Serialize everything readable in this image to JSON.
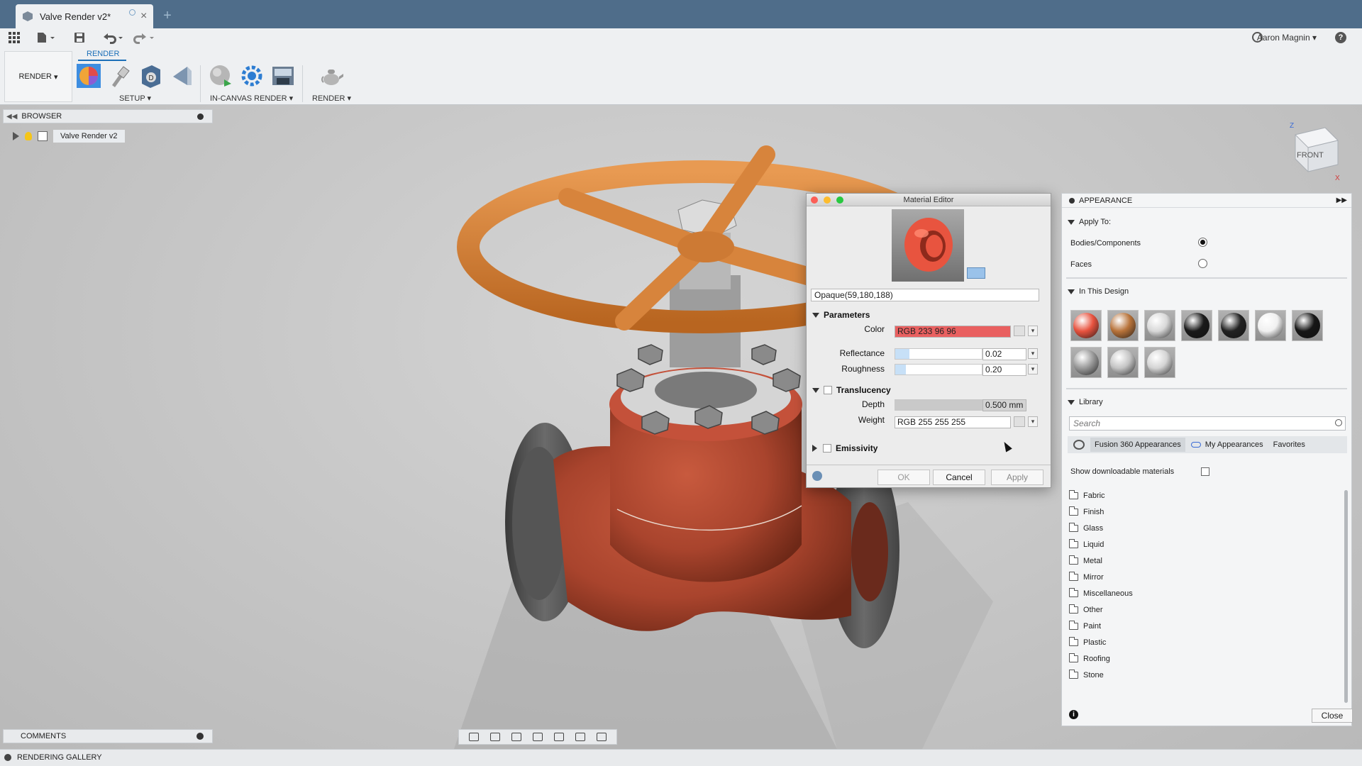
{
  "tab": {
    "title": "Valve Render v2*"
  },
  "user": {
    "name": "Aaron Magnin"
  },
  "ribbon": {
    "workspace": "RENDER",
    "active_tab": "RENDER",
    "groups": [
      "SETUP",
      "IN-CANVAS RENDER",
      "RENDER"
    ]
  },
  "browser": {
    "title": "BROWSER",
    "root": "Valve Render v2"
  },
  "comments": {
    "title": "COMMENTS"
  },
  "gallery": {
    "title": "RENDERING GALLERY"
  },
  "viewcube": {
    "face": "FRONT",
    "axis_z": "Z",
    "axis_x": "X"
  },
  "material_editor": {
    "title": "Material Editor",
    "name": "Opaque(59,180,188)",
    "parameters_label": "Parameters",
    "color_label": "Color",
    "color_value": "RGB 233 96 96",
    "color_hex": "#e96060",
    "reflectance_label": "Reflectance",
    "reflectance_value": "0.02",
    "reflectance_level": 0.02,
    "roughness_label": "Roughness",
    "roughness_value": "0.20",
    "roughness_level": 0.2,
    "translucency_label": "Translucency",
    "depth_label": "Depth",
    "depth_value": "0.500 mm",
    "weight_label": "Weight",
    "weight_value": "RGB 255 255 255",
    "emissivity_label": "Emissivity",
    "ok_label": "OK",
    "cancel_label": "Cancel",
    "apply_label": "Apply"
  },
  "appearance": {
    "title": "APPEARANCE",
    "apply_to_label": "Apply To:",
    "bodies_label": "Bodies/Components",
    "faces_label": "Faces",
    "apply_to_selected": "Bodies/Components",
    "in_design_label": "In This Design",
    "swatches": [
      {
        "name": "red-ring",
        "color": "#e8533f"
      },
      {
        "name": "bronze-ring",
        "color": "#b8733a"
      },
      {
        "name": "silver-ring",
        "color": "#d8d8d8"
      },
      {
        "name": "black-sphere",
        "color": "#1a1a1a"
      },
      {
        "name": "black-ring",
        "color": "#222222"
      },
      {
        "name": "white-sphere",
        "color": "#f0f0f0"
      },
      {
        "name": "black-ring-2",
        "color": "#161616"
      },
      {
        "name": "chrome-sphere",
        "color": "#9a9a9a"
      },
      {
        "name": "grey-ring",
        "color": "#c4c4c4"
      },
      {
        "name": "light-ring",
        "color": "#d4d4d4"
      }
    ],
    "library_label": "Library",
    "search_placeholder": "Search",
    "lib_tabs": [
      "Fusion 360 Appearances",
      "My Appearances",
      "Favorites"
    ],
    "show_downloadable_label": "Show downloadable materials",
    "folders": [
      "Fabric",
      "Finish",
      "Glass",
      "Liquid",
      "Metal",
      "Mirror",
      "Miscellaneous",
      "Other",
      "Paint",
      "Plastic",
      "Roofing",
      "Stone"
    ],
    "close_label": "Close"
  }
}
